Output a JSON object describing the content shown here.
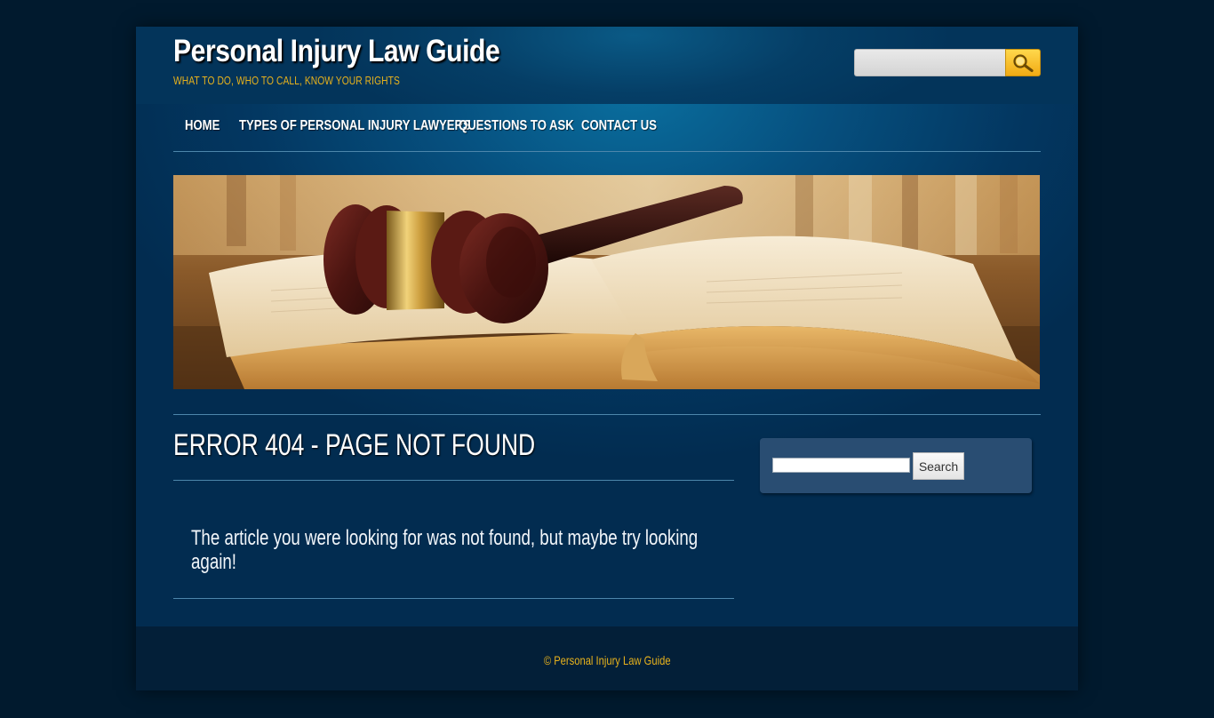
{
  "site": {
    "title": "Personal Injury Law Guide",
    "tagline": "WHAT TO DO, WHO TO CALL, KNOW YOUR RIGHTS"
  },
  "header_search": {
    "value": "",
    "button_icon": "magnifier-icon"
  },
  "nav": {
    "items": [
      {
        "label": "HOME"
      },
      {
        "label": "TYPES OF PERSONAL INJURY LAWYERS"
      },
      {
        "label": "QUESTIONS TO ASK"
      },
      {
        "label": "CONTACT US"
      }
    ]
  },
  "banner": {
    "image": "gavel-on-open-law-book-photo"
  },
  "main": {
    "title": "ERROR 404 - PAGE NOT FOUND",
    "message": "The article you were looking for was not found, but maybe try looking again!"
  },
  "sidebar": {
    "search_value": "",
    "search_button": "Search"
  },
  "footer": {
    "copyright": "© Personal Injury Law Guide"
  },
  "colors": {
    "background": "#011a2e",
    "accent": "#e8b21c",
    "panel": "#294d72"
  }
}
